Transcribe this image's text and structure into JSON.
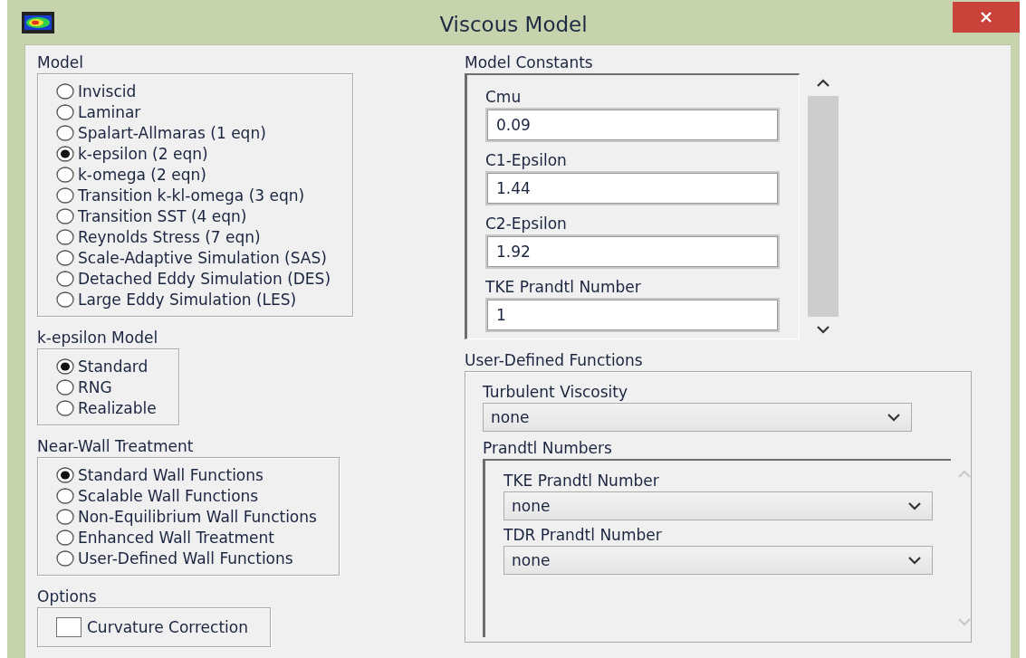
{
  "window": {
    "title": "Viscous Model"
  },
  "model": {
    "label": "Model",
    "options": [
      {
        "label": "Inviscid",
        "selected": false
      },
      {
        "label": "Laminar",
        "selected": false
      },
      {
        "label": "Spalart-Allmaras (1 eqn)",
        "selected": false
      },
      {
        "label": "k-epsilon (2 eqn)",
        "selected": true
      },
      {
        "label": "k-omega (2 eqn)",
        "selected": false
      },
      {
        "label": "Transition k-kl-omega (3 eqn)",
        "selected": false
      },
      {
        "label": "Transition SST (4 eqn)",
        "selected": false
      },
      {
        "label": "Reynolds Stress (7 eqn)",
        "selected": false
      },
      {
        "label": "Scale-Adaptive Simulation (SAS)",
        "selected": false
      },
      {
        "label": "Detached Eddy Simulation (DES)",
        "selected": false
      },
      {
        "label": "Large Eddy Simulation (LES)",
        "selected": false
      }
    ]
  },
  "k_epsilon_model": {
    "label": "k-epsilon Model",
    "options": [
      {
        "label": "Standard",
        "selected": true
      },
      {
        "label": "RNG",
        "selected": false
      },
      {
        "label": "Realizable",
        "selected": false
      }
    ]
  },
  "near_wall_treatment": {
    "label": "Near-Wall Treatment",
    "options": [
      {
        "label": "Standard Wall Functions",
        "selected": true
      },
      {
        "label": "Scalable Wall Functions",
        "selected": false
      },
      {
        "label": "Non-Equilibrium Wall Functions",
        "selected": false
      },
      {
        "label": "Enhanced Wall Treatment",
        "selected": false
      },
      {
        "label": "User-Defined Wall Functions",
        "selected": false
      }
    ]
  },
  "options": {
    "label": "Options",
    "items": [
      {
        "label": "Curvature Correction",
        "checked": false
      }
    ]
  },
  "model_constants": {
    "label": "Model Constants",
    "fields": [
      {
        "label": "Cmu",
        "value": "0.09"
      },
      {
        "label": "C1-Epsilon",
        "value": "1.44"
      },
      {
        "label": "C2-Epsilon",
        "value": "1.92"
      },
      {
        "label": "TKE Prandtl Number",
        "value": "1"
      }
    ]
  },
  "user_defined_functions": {
    "label": "User-Defined Functions",
    "turbulent_viscosity": {
      "label": "Turbulent Viscosity",
      "value": "none"
    },
    "prandtl_numbers": {
      "label": "Prandtl Numbers",
      "fields": [
        {
          "label": "TKE Prandtl Number",
          "value": "none"
        },
        {
          "label": "TDR Prandtl Number",
          "value": "none"
        }
      ]
    }
  }
}
